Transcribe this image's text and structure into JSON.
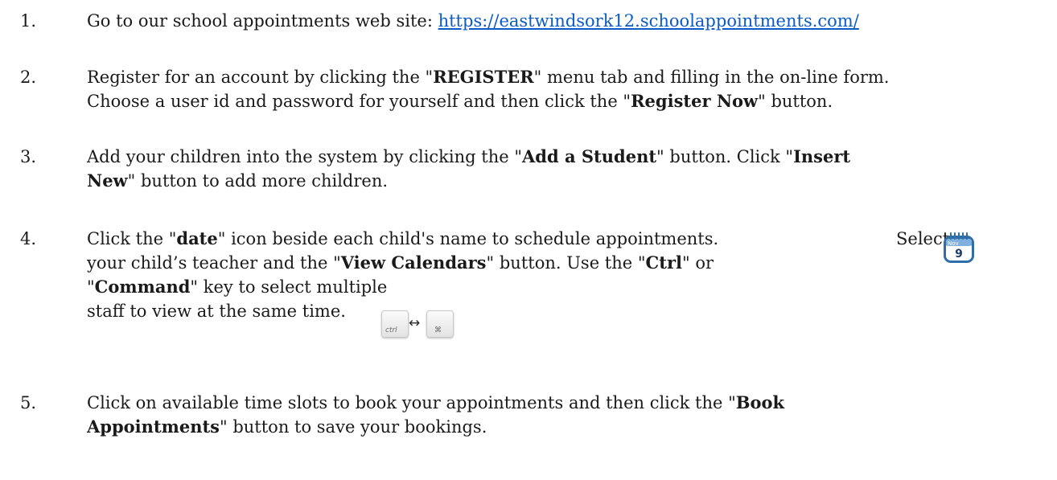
{
  "steps": [
    {
      "number": "1.",
      "lines": [
        {
          "pre": "Go to our school appointments web site: ",
          "link": "https://eastwindsork12.schoolappointments.com/"
        }
      ]
    },
    {
      "number": "2.",
      "lines": [
        {
          "t1": "Register for an account by clicking the \"",
          "b1": "REGISTER",
          "t2": "\" menu tab and filling in the on-line form."
        },
        {
          "t1": "Choose a user id and password for yourself and then click the \"",
          "b1": "Register Now",
          "t2": "\" button."
        }
      ]
    },
    {
      "number": "3.",
      "lines": [
        {
          "t1": "Add your children into the system by clicking the \"",
          "b1": "Add a Student",
          "t2": "\" button.  Click \"",
          "b2": "Insert"
        },
        {
          "b1": "New",
          "t2": "\" button to add more children."
        }
      ]
    },
    {
      "number": "4.",
      "lines": [
        {
          "t1": "Click the \"",
          "b1": "date",
          "t2": "\" icon beside each child's name to schedule appointments.",
          "t3": "Select"
        },
        {
          "t1": "your child’s teacher and the \"",
          "b1": "View Calendars",
          "t2": "\" button.  Use the \"",
          "b2": "Ctrl",
          "t3": "\" or"
        },
        {
          "t1": "\"",
          "b1": "Command",
          "t2": "\" key to select multiple"
        },
        {
          "t1": "staff to view at the same time."
        }
      ]
    },
    {
      "number": "5.",
      "lines": [
        {
          "t1": "Click on available time slots to book your appointments and then click the \"",
          "b1": "Book"
        },
        {
          "b1": "Appointments",
          "t2": "\"   button to save your bookings."
        }
      ]
    }
  ],
  "icons": {
    "calendar": {
      "month": "Nov",
      "day": "9"
    },
    "keys": {
      "ctrl_label": "ctrl",
      "cmd_label": "⌘"
    }
  },
  "colors": {
    "link": "#0b5bc9",
    "calendar_accent": "#2d6ea8"
  }
}
